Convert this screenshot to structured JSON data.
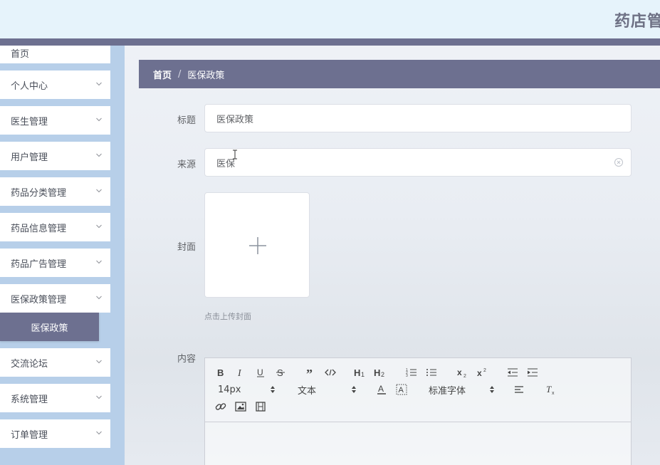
{
  "header": {
    "title": "药店管"
  },
  "sidebar": {
    "items": [
      {
        "label": "首页"
      },
      {
        "label": "个人中心"
      },
      {
        "label": "医生管理"
      },
      {
        "label": "用户管理"
      },
      {
        "label": "药品分类管理"
      },
      {
        "label": "药品信息管理"
      },
      {
        "label": "药品广告管理"
      },
      {
        "label": "医保政策管理"
      },
      {
        "label": "交流论坛"
      },
      {
        "label": "系统管理"
      },
      {
        "label": "订单管理"
      }
    ],
    "active_sub": "医保政策"
  },
  "breadcrumb": {
    "home": "首页",
    "separator": "/",
    "current": "医保政策"
  },
  "form": {
    "title_label": "标题",
    "title_value": "医保政策",
    "source_label": "来源",
    "source_value": "医保",
    "cover_label": "封面",
    "cover_tip": "点击上传封面",
    "content_label": "内容"
  },
  "editor": {
    "size": "14px",
    "header": "文本",
    "font": "标准字体",
    "icons": [
      "bold-icon",
      "italic-icon",
      "underline-icon",
      "strike-icon",
      "blockquote-icon",
      "code-block-icon",
      "h1-icon",
      "h2-icon",
      "ordered-list-icon",
      "bullet-list-icon",
      "subscript-icon",
      "superscript-icon",
      "outdent-icon",
      "indent-icon",
      "font-color-icon",
      "background-color-icon",
      "align-icon",
      "clear-format-icon",
      "link-icon",
      "image-icon",
      "video-icon"
    ]
  },
  "colors": {
    "accent": "#6d7090",
    "sidebar_bg": "#b7cfe9",
    "topbar_bg": "#e6f3fb"
  }
}
